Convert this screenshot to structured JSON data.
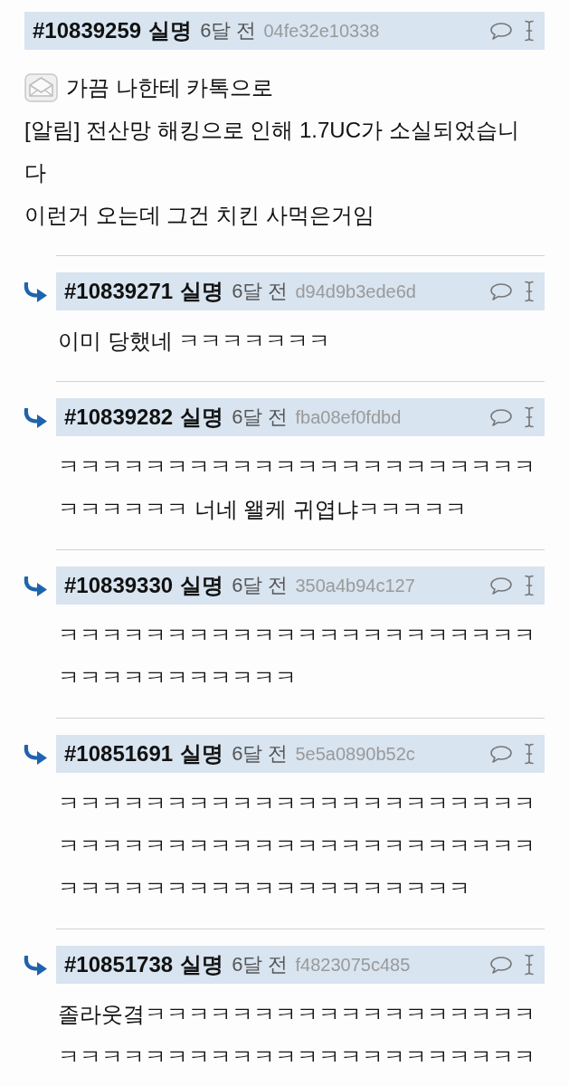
{
  "comments": [
    {
      "kind": "post",
      "number": "#10839259",
      "author": "실명",
      "time": "6달 전",
      "hash": "04fe32e10338",
      "leading_icon": true,
      "lines": [
        "가끔 나한테 카톡으로",
        "[알림] 전산망 해킹으로 인해 1.7UC가 소실되었습니",
        "다",
        "이런거 오는데 그건 치킨 사먹은거임"
      ]
    },
    {
      "kind": "reply",
      "number": "#10839271",
      "author": "실명",
      "time": "6달 전",
      "hash": "d94d9b3ede6d",
      "lines": [
        "이미 당했네 ㅋㅋㅋㅋㅋㅋㅋ"
      ]
    },
    {
      "kind": "reply",
      "number": "#10839282",
      "author": "실명",
      "time": "6달 전",
      "hash": "fba08ef0fdbd",
      "lines": [
        "ㅋㅋㅋㅋㅋㅋㅋㅋㅋㅋㅋㅋㅋㅋㅋㅋㅋㅋㅋㅋㅋㅋ",
        "ㅋㅋㅋㅋㅋㅋ 너네 왤케 귀엽냐ㅋㅋㅋㅋㅋ"
      ]
    },
    {
      "kind": "reply",
      "number": "#10839330",
      "author": "실명",
      "time": "6달 전",
      "hash": "350a4b94c127",
      "lines": [
        "ㅋㅋㅋㅋㅋㅋㅋㅋㅋㅋㅋㅋㅋㅋㅋㅋㅋㅋㅋㅋㅋㅋ",
        "ㅋㅋㅋㅋㅋㅋㅋㅋㅋㅋㅋ"
      ]
    },
    {
      "kind": "reply",
      "number": "#10851691",
      "author": "실명",
      "time": "6달 전",
      "hash": "5e5a0890b52c",
      "lines": [
        "ㅋㅋㅋㅋㅋㅋㅋㅋㅋㅋㅋㅋㅋㅋㅋㅋㅋㅋㅋㅋㅋㅋ",
        "ㅋㅋㅋㅋㅋㅋㅋㅋㅋㅋㅋㅋㅋㅋㅋㅋㅋㅋㅋㅋㅋㅋ",
        "ㅋㅋㅋㅋㅋㅋㅋㅋㅋㅋㅋㅋㅋㅋㅋㅋㅋㅋㅋ"
      ]
    },
    {
      "kind": "reply",
      "number": "#10851738",
      "author": "실명",
      "time": "6달 전",
      "hash": "f4823075c485",
      "lines": [
        "졸라웃곀ㅋㅋㅋㅋㅋㅋㅋㅋㅋㅋㅋㅋㅋㅋㅋㅋㅋㅋ",
        "ㅋㅋㅋㅋㅋㅋㅋㅋㅋㅋㅋㅋㅋㅋㅋㅋㅋㅋㅋㅋㅋㅋ"
      ]
    }
  ]
}
